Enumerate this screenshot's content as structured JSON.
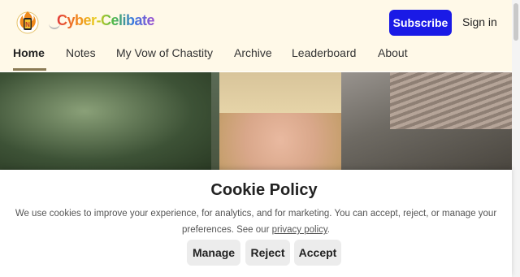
{
  "header": {
    "brand": "Cyber-Celibate",
    "subscribe_label": "Subscribe",
    "signin_label": "Sign in",
    "accent_color": "#1a1ae6",
    "background_color": "#fff9e8"
  },
  "nav": {
    "items": [
      {
        "label": "Home",
        "active": true
      },
      {
        "label": "Notes"
      },
      {
        "label": "My Vow of Chastity"
      },
      {
        "label": "Archive"
      },
      {
        "label": "Leaderboard"
      },
      {
        "label": "About"
      }
    ]
  },
  "cookie": {
    "title": "Cookie Policy",
    "text": "We use cookies to improve your experience, for analytics, and for marketing. You can accept, reject, or manage your preferences. See our",
    "link_label": "privacy policy",
    "buttons": [
      "Manage",
      "Reject",
      "Accept"
    ]
  }
}
